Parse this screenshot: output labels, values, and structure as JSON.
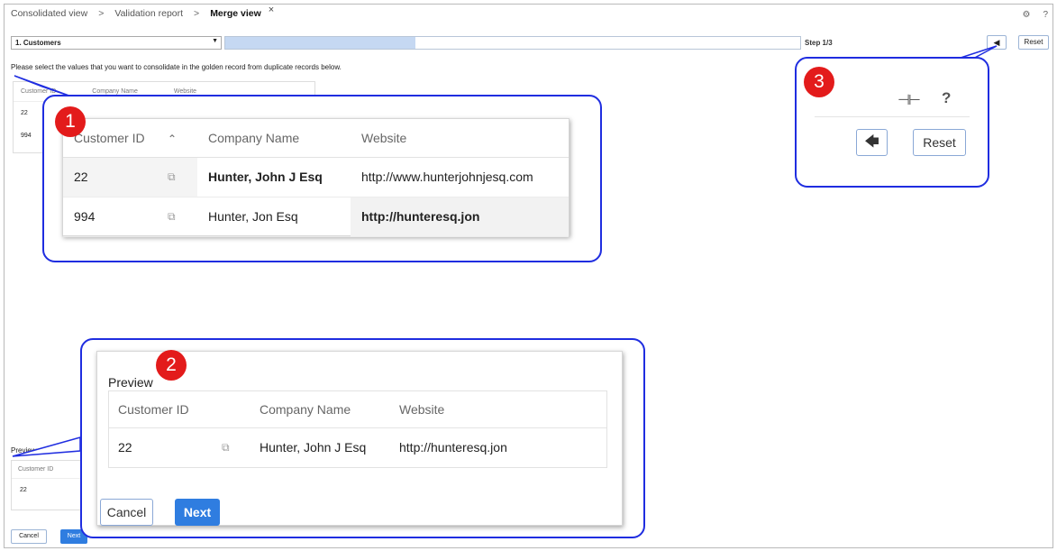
{
  "breadcrumbs": [
    "Consolidated view",
    "Validation report",
    "Merge view"
  ],
  "breadcrumb_separator": ">",
  "close_glyph": "×",
  "top_right_icons": [
    "settings-icon",
    "help-icon"
  ],
  "step_select": {
    "value": "1. Customers"
  },
  "progress": {
    "fraction": 0.33
  },
  "step_label": "Step 1/3",
  "small_reset_label": "Reset",
  "instruction": "Please select the values that you want to consolidate in the golden record from duplicate records below.",
  "background_table": {
    "columns": [
      "Customer ID",
      "Company Name",
      "Website"
    ],
    "rows": [
      "22",
      "994"
    ]
  },
  "small_preview": {
    "label": "Preview",
    "column": "Customer ID",
    "value": "22",
    "cancel_label": "Cancel",
    "next_label": "Next"
  },
  "callout1": {
    "badge": "1",
    "columns": [
      "Customer ID",
      "Company Name",
      "Website"
    ],
    "sort_glyph": "^",
    "rows": [
      {
        "id": "22",
        "company": "Hunter, John J Esq",
        "website": "http://www.hunterjohnjesq.com"
      },
      {
        "id": "994",
        "company": "Hunter, Jon Esq",
        "website": "http://hunteresq.jon"
      }
    ]
  },
  "callout2": {
    "badge": "2",
    "title": "Preview",
    "columns": [
      "Customer ID",
      "Company Name",
      "Website"
    ],
    "row": {
      "id": "22",
      "company": "Hunter, John J Esq",
      "website": "http://hunteresq.jon"
    },
    "cancel_label": "Cancel",
    "next_label": "Next"
  },
  "callout3": {
    "badge": "3",
    "reset_label": "Reset",
    "help_glyph": "?"
  },
  "colors": {
    "accent": "#2f7de0",
    "callout_border": "#1f2de0",
    "badge": "#e31b1b",
    "progress_fill": "#c5d8f2"
  }
}
